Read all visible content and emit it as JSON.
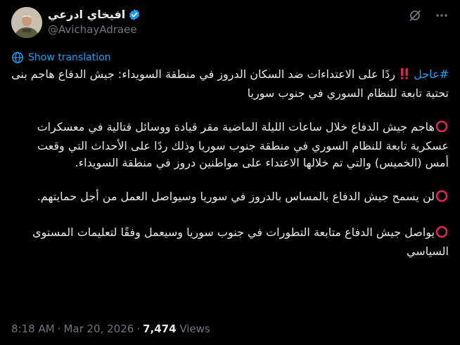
{
  "author": {
    "display_name": "افيخاي ادرعي",
    "handle": "@AvichayAdraee"
  },
  "top_icons": [
    "grok-icon",
    "more-icon"
  ],
  "show_translation_label": "Show translation",
  "tweet": {
    "p1": {
      "hashtag": "#عاجل",
      "text": "ردًا على الاعتداءات ضد السكان الدروز في منطقة السويداء: جيش الدفاع هاجم بنى تحتية تابعة للنظام السوري في جنوب سوريا"
    },
    "p2": "هاجم جيش الدفاع خلال ساعات الليلة الماضية مقر قيادة ووسائل قتالية في معسكرات عسكرية تابعة للنظام السوري في منطقة جنوب سوريا وذلك ردًا على الأحداث التي وقعت أمس (الخميس) والتي تم خلالها الاعتداء على مواطنين دروز في منطقة السويداء.",
    "p3": "لن يسمح جيش الدفاع بالمساس بالدروز في سوريا وسيواصل العمل من أجل حمايتهم.",
    "p4": "يواصل جيش الدفاع متابعة التطورات في جنوب سوريا وسيعمل وفقًا لتعليمات المستوى السياسي"
  },
  "meta": {
    "time": "8:18 AM",
    "separator": "·",
    "date": "Mar 20, 2026",
    "views_count": "7,474",
    "views_label": "Views"
  },
  "colors": {
    "background": "#000000",
    "text": "#e7e9ea",
    "secondary": "#71767b",
    "accent": "#1d9bf0",
    "emoji_red": "#e0245e"
  }
}
